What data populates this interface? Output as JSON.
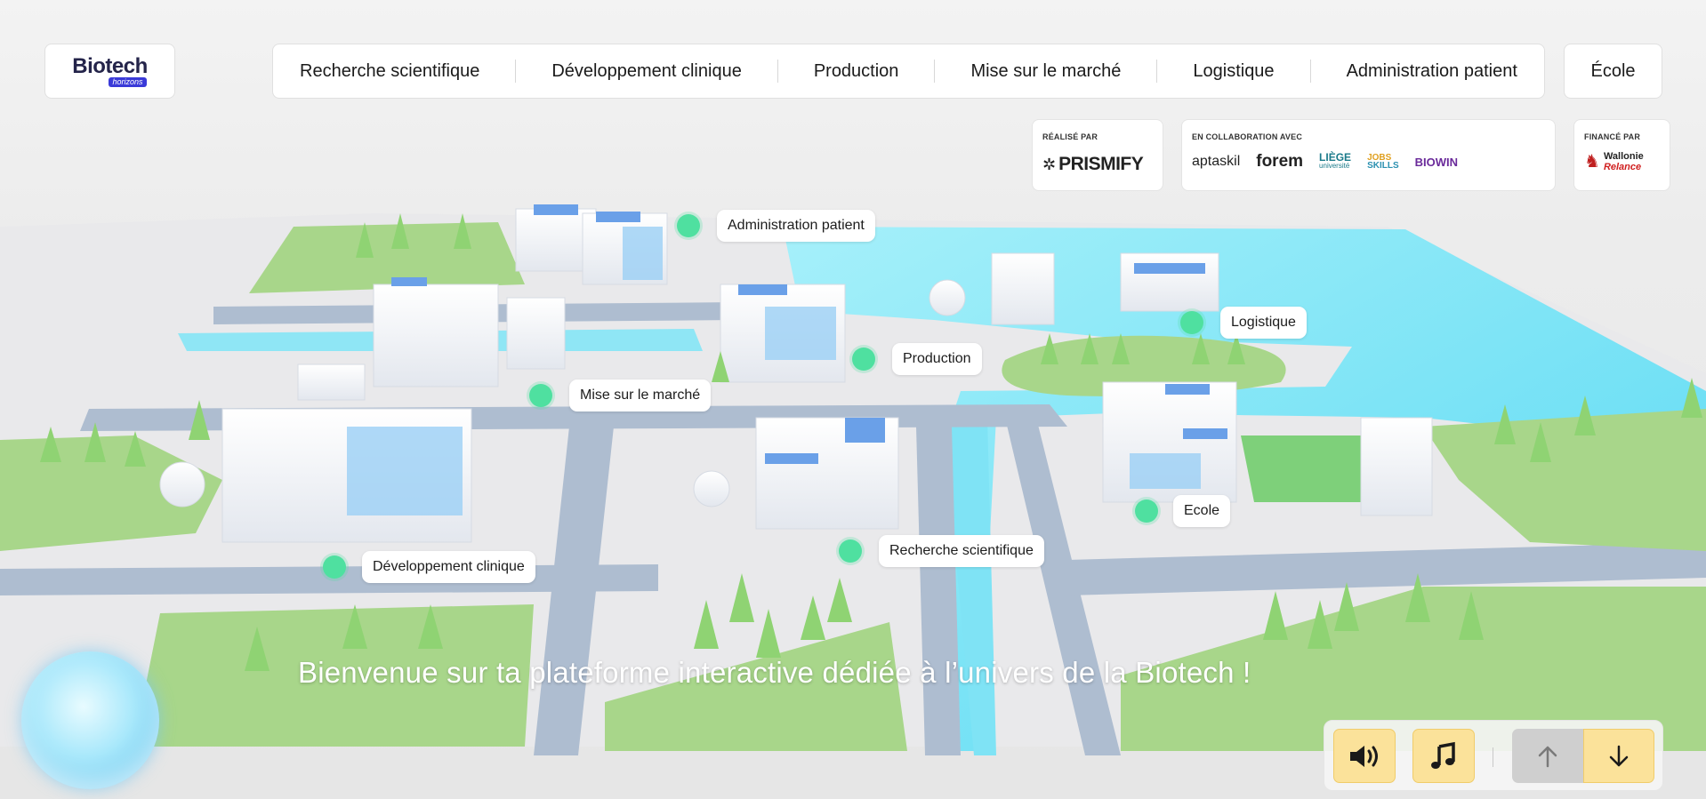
{
  "logo": {
    "title": "Biotech",
    "subtitle": "horizons"
  },
  "nav": {
    "items": [
      "Recherche scientifique",
      "Développement clinique",
      "Production",
      "Mise sur le marché",
      "Logistique",
      "Administration patient"
    ],
    "ecole": "École"
  },
  "partners": {
    "realise": {
      "label": "RÉALISÉ PAR",
      "logo": "PRISMIFY"
    },
    "collab": {
      "label": "EN COLLABORATION AVEC",
      "logos": [
        "aptaskil",
        "forem",
        "LIÈGE",
        "université",
        "JOBS",
        "SKILLS",
        "BIOWIN"
      ]
    },
    "finance": {
      "label": "FINANCÉ PAR",
      "logo1": "Wallonie",
      "logo2": "Relance"
    }
  },
  "hotspots": {
    "admin": "Administration patient",
    "logistique": "Logistique",
    "production": "Production",
    "mise": "Mise sur le marché",
    "ecole": "Ecole",
    "recherche": "Recherche scientifique",
    "dev": "Développement clinique"
  },
  "welcome": "Bienvenue sur ta plateforme interactive dédiée à l’univers de la Biotech !",
  "controls": {
    "sound_icon": "speaker-icon",
    "music_icon": "music-note-icon",
    "up_icon": "arrow-up-icon",
    "down_icon": "arrow-down-icon"
  },
  "colors": {
    "hotspot": "#4fe0a0",
    "water": "#7fe3f5",
    "grass": "#a8d68a",
    "road": "#a9b8cc",
    "control_yellow": "#fbe29a"
  }
}
